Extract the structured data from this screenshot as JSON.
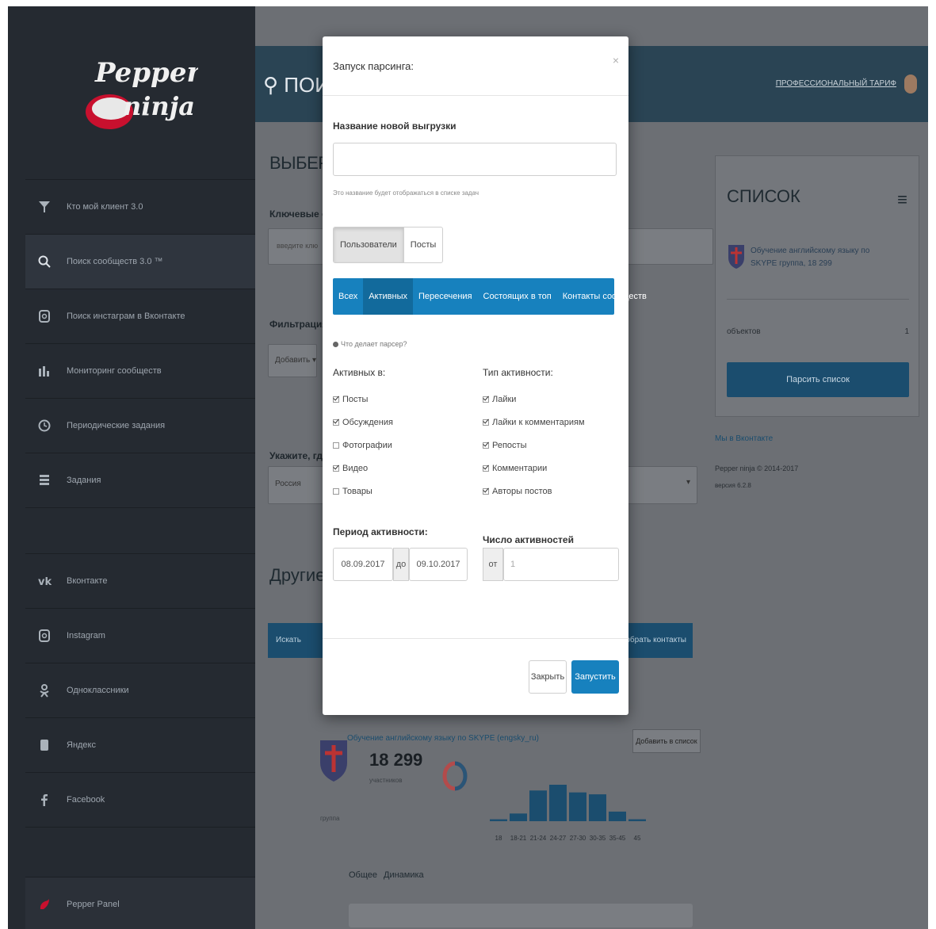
{
  "sidebar": {
    "items": [
      {
        "label": "Кто мой клиент 3.0",
        "icon": "funnel-icon"
      },
      {
        "label": "Поиск сообществ 3.0 ™",
        "icon": "search-icon"
      },
      {
        "label": "Поиск инстаграм в Вконтакте",
        "icon": "instagram-icon"
      },
      {
        "label": "Мониторинг сообществ",
        "icon": "bar-chart-icon"
      },
      {
        "label": "Периодические задания",
        "icon": "clock-icon"
      },
      {
        "label": "Задания",
        "icon": "list-icon"
      }
    ],
    "social": [
      {
        "label": "Вконтакте",
        "icon": "vk-icon"
      },
      {
        "label": "Instagram",
        "icon": "instagram-icon"
      },
      {
        "label": "Одноклассники",
        "icon": "ok-icon"
      },
      {
        "label": "Яндекс",
        "icon": "yandex-icon"
      },
      {
        "label": "Facebook",
        "icon": "facebook-icon"
      }
    ],
    "footer": {
      "label": "Pepper Panel",
      "icon": "pepper-icon"
    }
  },
  "header": {
    "search_text": "ПОИС",
    "user_label": "ПРОФЕССИОНАЛЬНЫЙ ТАРИФ"
  },
  "background": {
    "page_heading": "ВЫБЕРИТЕ",
    "keywords_label": "Ключевые сло",
    "keywords_placeholder": "введите клю",
    "filter_label": "Фильтрация п",
    "add_button": "Добавить ▾",
    "location_label": "Укажите, где и",
    "location_value": "Россия",
    "other_heading": "Другие о",
    "right_title": "СПИСОК",
    "right_item": "Обучение английскому языку по SKYPE группа, 18 299",
    "right_objects": "объектов",
    "right_objects_count": "1",
    "right_button": "Парсить список",
    "vk_link": "Мы в Вконтакте",
    "copyright": "Pepper ninja © 2014-2017",
    "version": "версия 6.2.8",
    "strip_left": "Искать",
    "strip_right": "обрать контакты",
    "group_name": "Обучение английскому языку по SKYPE (engsky_ru)",
    "add_to_list": "Добавить в список",
    "members_count": "18 299",
    "members_label": "участников",
    "group_type": "группа",
    "age_labels": [
      "18",
      "18-21",
      "21-24",
      "24-27",
      "27-30",
      "30-35",
      "35-45",
      "45"
    ],
    "age_values": [
      1,
      4,
      16,
      19,
      15,
      14,
      5,
      1
    ],
    "tabs_bottom": [
      "Общее",
      "Динамика"
    ]
  },
  "modal": {
    "title": "Запуск парсинга:",
    "close_symbol": "×",
    "name_label": "Название новой выгрузки",
    "name_value": "",
    "name_help": "Это название будет отображаться в списке задач",
    "segment": [
      "Пользователи",
      "Посты"
    ],
    "segment_active": 0,
    "tabs": [
      "Всех",
      "Активных",
      "Пересечения",
      "Состоящих в топ",
      "Контакты сообществ"
    ],
    "tab_active": 1,
    "info_link": "Что делает парсер?",
    "active_in_label": "Активных в:",
    "active_in": [
      {
        "label": "Посты",
        "checked": true
      },
      {
        "label": "Обсуждения",
        "checked": true
      },
      {
        "label": "Фотографии",
        "checked": false
      },
      {
        "label": "Видео",
        "checked": true
      },
      {
        "label": "Товары",
        "checked": false
      }
    ],
    "activity_type_label": "Тип активности:",
    "activity_type": [
      {
        "label": "Лайки",
        "checked": true
      },
      {
        "label": "Лайки к комментариям",
        "checked": true
      },
      {
        "label": "Репосты",
        "checked": true
      },
      {
        "label": "Комментарии",
        "checked": true
      },
      {
        "label": "Авторы постов",
        "checked": true
      }
    ],
    "period_label": "Период активности:",
    "date_from": "08.09.2017",
    "date_to_label": "до",
    "date_to": "09.10.2017",
    "count_label": "Число активностей",
    "count_prefix": "от",
    "count_value": "1",
    "btn_close": "Закрыть",
    "btn_run": "Запустить"
  }
}
